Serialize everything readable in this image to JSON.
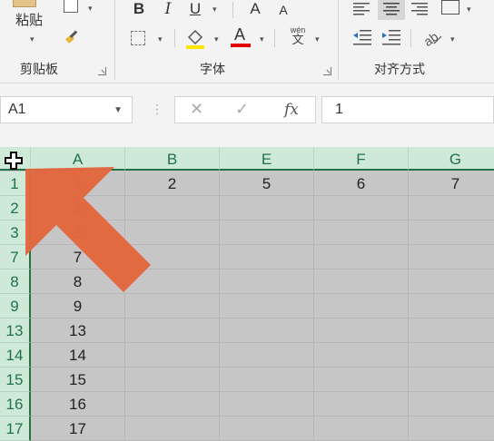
{
  "ribbon": {
    "clipboard": {
      "paste_label": "粘贴",
      "group_label": "剪贴板"
    },
    "font": {
      "bold": "B",
      "italic": "I",
      "underline": "U",
      "grow": "A",
      "shrink": "A",
      "wen": "wén",
      "wen_char": "文",
      "font_color_letter": "A",
      "group_label": "字体"
    },
    "alignment": {
      "group_label": "对齐方式"
    }
  },
  "formula_bar": {
    "name_box": "A1",
    "cancel": "✕",
    "enter": "✓",
    "fx": "fx",
    "value": "1"
  },
  "grid": {
    "columns": [
      {
        "label": "A",
        "width": 104
      },
      {
        "label": "B",
        "width": 104
      },
      {
        "label": "E",
        "width": 104
      },
      {
        "label": "F",
        "width": 104
      },
      {
        "label": "G",
        "width": 104
      }
    ],
    "rows": [
      {
        "label": "1",
        "cells": [
          "1",
          "2",
          "5",
          "6",
          "7"
        ]
      },
      {
        "label": "2",
        "cells": [
          "2",
          "",
          "",
          "",
          ""
        ]
      },
      {
        "label": "3",
        "cells": [
          "3",
          "",
          "",
          "",
          ""
        ]
      },
      {
        "label": "7",
        "cells": [
          "7",
          "",
          "",
          "",
          ""
        ]
      },
      {
        "label": "8",
        "cells": [
          "8",
          "",
          "",
          "",
          ""
        ]
      },
      {
        "label": "9",
        "cells": [
          "9",
          "",
          "",
          "",
          ""
        ]
      },
      {
        "label": "13",
        "cells": [
          "13",
          "",
          "",
          "",
          ""
        ]
      },
      {
        "label": "14",
        "cells": [
          "14",
          "",
          "",
          "",
          ""
        ]
      },
      {
        "label": "15",
        "cells": [
          "15",
          "",
          "",
          "",
          ""
        ]
      },
      {
        "label": "16",
        "cells": [
          "16",
          "",
          "",
          "",
          ""
        ]
      },
      {
        "label": "17",
        "cells": [
          "17",
          "",
          "",
          "",
          ""
        ]
      }
    ]
  },
  "colors": {
    "accent": "#217346",
    "header_bg": "#cfe9d9",
    "selection_bg": "#c6c6c6",
    "arrow": "#e2673f"
  }
}
